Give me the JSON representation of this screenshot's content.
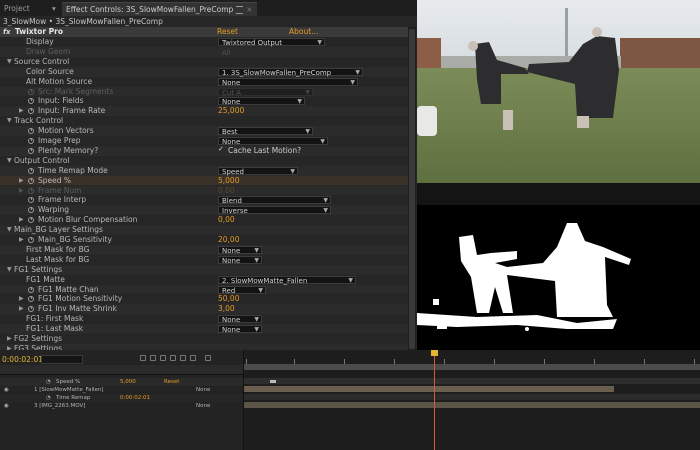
{
  "tabs": {
    "project": "Project",
    "effect_controls": "Effect Controls: 3S_SlowMowFallen_PreComp"
  },
  "breadcrumb": "3_SlowMow • 3S_SlowMowFallen_PreComp",
  "effect": {
    "badge": "fx",
    "name": "Twixtor Pro",
    "reset": "Reset",
    "about": "About..."
  },
  "rows": {
    "display": {
      "label": "Display",
      "value": "Twixtored Output"
    },
    "draw_geom": {
      "label": "Draw Geom",
      "value": "All"
    },
    "source_control": {
      "label": "Source Control"
    },
    "color_source": {
      "label": "Color Source",
      "value": "1. 3S_SlowMowFallen_PreComp"
    },
    "alt_motion_source": {
      "label": "Alt Motion Source",
      "value": "None"
    },
    "src_mark_segments": {
      "label": "Src: Mark Segments",
      "value": "Cut A"
    },
    "input_fields": {
      "label": "Input: Fields",
      "value": "None"
    },
    "input_frame_rate": {
      "label": "Input: Frame Rate",
      "value": "25,000"
    },
    "track_control": {
      "label": "Track Control"
    },
    "motion_vectors": {
      "label": "Motion Vectors",
      "value": "Best"
    },
    "image_prep": {
      "label": "Image Prep",
      "value": "None"
    },
    "plenty_memory": {
      "label": "Plenty Memory?",
      "checkbox": "Cache Last Motion?"
    },
    "output_control": {
      "label": "Output Control"
    },
    "time_remap_mode": {
      "label": "Time Remap Mode",
      "value": "Speed"
    },
    "speed": {
      "label": "Speed %",
      "value": "5,000"
    },
    "frame_num": {
      "label": "Frame Num",
      "value": "0,00"
    },
    "frame_interp": {
      "label": "Frame Interp",
      "value": "Blend"
    },
    "warping": {
      "label": "Warping",
      "value": "Inverse"
    },
    "motion_blur_comp": {
      "label": "Motion Blur Compensation",
      "value": "0,00"
    },
    "main_bg_layer_settings": {
      "label": "Main_BG Layer Settings"
    },
    "main_bg_sensitivity": {
      "label": "Main_BG Sensitivity",
      "value": "20,00"
    },
    "first_mask_bg": {
      "label": "First Mask for BG",
      "value": "None"
    },
    "last_mask_bg": {
      "label": "Last Mask for BG",
      "value": "None"
    },
    "fg1_settings": {
      "label": "FG1 Settings"
    },
    "fg1_matte": {
      "label": "FG1 Matte",
      "value": "2. SlowMowMatte_Fallen"
    },
    "fg1_matte_chan": {
      "label": "FG1 Matte Chan",
      "value": "Red"
    },
    "fg1_motion_sensitivity": {
      "label": "FG1 Motion Sensitivity",
      "value": "50,00"
    },
    "fg1_inv_matte_shrink": {
      "label": "FG1 Inv Matte Shrink",
      "value": "3,00"
    },
    "fg1_first_mask": {
      "label": "FG1: First Mask",
      "value": "None"
    },
    "fg1_last_mask": {
      "label": "FG1: Last Mask",
      "value": "None"
    },
    "fg2_settings": {
      "label": "FG2 Settings"
    },
    "fg3_settings": {
      "label": "FG3 Settings"
    }
  },
  "timeline": {
    "timecode": "0:00:02:01",
    "speed_row": "Speed %",
    "speed_value": "5,000",
    "reset_label": "Reset",
    "layer1": "1  [SlowMowMatte_Fallen]",
    "layer2": "Time Remap",
    "layer2_value": "0:00:02:01",
    "layer3": "3  [IMG_2263.MOV]",
    "mode_none": "None"
  },
  "colors": {
    "accent_value": "#e39a25",
    "panel_bg": "#262626",
    "playhead": "#d45a3c"
  }
}
